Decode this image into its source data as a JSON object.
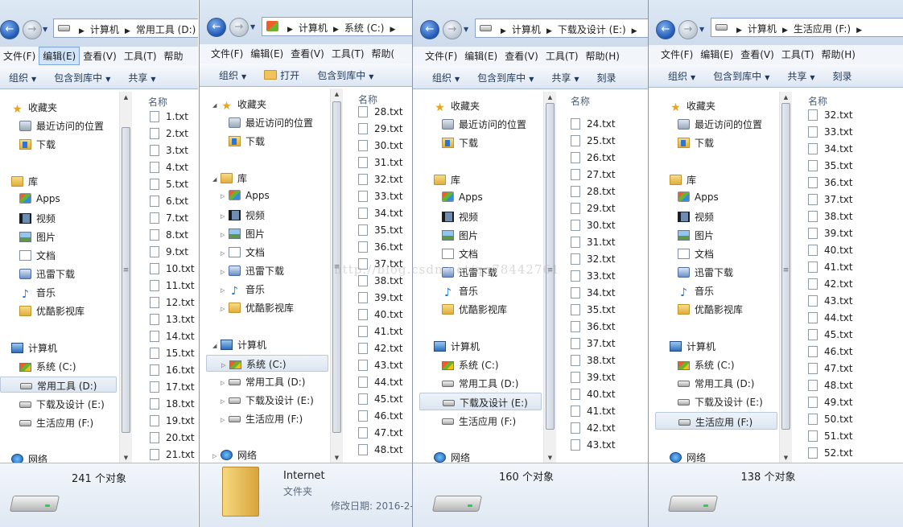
{
  "windows": [
    {
      "address": [
        "计算机",
        "常用工具 (D:)"
      ],
      "menu": [
        "文件(F)",
        "编辑(E)",
        "查看(V)",
        "工具(T)",
        "帮助"
      ],
      "active_menu": 1,
      "toolbar": [
        "组织",
        "包含到库中",
        "共享"
      ],
      "column_header": "名称",
      "files": [
        "1.txt",
        "2.txt",
        "3.txt",
        "4.txt",
        "5.txt",
        "6.txt",
        "7.txt",
        "8.txt",
        "9.txt",
        "10.txt",
        "11.txt",
        "12.txt",
        "13.txt",
        "14.txt",
        "15.txt",
        "16.txt",
        "17.txt",
        "18.txt",
        "19.txt",
        "20.txt",
        "21.txt"
      ],
      "object_count": "241 个对象",
      "nav": {
        "favorites": "收藏夹",
        "recent": "最近访问的位置",
        "downloads": "下载",
        "library": "库",
        "apps": "Apps",
        "video": "视频",
        "pictures": "图片",
        "docs": "文档",
        "xunlei": "迅雷下载",
        "music": "音乐",
        "youku": "优酷影视库",
        "computer": "计算机",
        "c": "系统 (C:)",
        "d": "常用工具 (D:)",
        "e": "下载及设计 (E:)",
        "f": "生活应用 (F:)",
        "network": "网络"
      }
    },
    {
      "address": [
        "计算机",
        "系统 (C:)"
      ],
      "menu": [
        "文件(F)",
        "编辑(E)",
        "查看(V)",
        "工具(T)",
        "帮助("
      ],
      "toolbar": [
        "组织",
        "打开",
        "包含到库中"
      ],
      "column_header": "名称",
      "files": [
        "28.txt",
        "29.txt",
        "30.txt",
        "31.txt",
        "32.txt",
        "33.txt",
        "34.txt",
        "35.txt",
        "36.txt",
        "37.txt",
        "38.txt",
        "39.txt",
        "40.txt",
        "41.txt",
        "42.txt",
        "43.txt",
        "44.txt",
        "45.txt",
        "46.txt",
        "47.txt",
        "48.txt"
      ],
      "details": {
        "name": "Internet",
        "type": "文件夹",
        "modified": "修改日期: 2016-2-"
      }
    },
    {
      "address": [
        "计算机",
        "下载及设计 (E:)"
      ],
      "menu": [
        "文件(F)",
        "编辑(E)",
        "查看(V)",
        "工具(T)",
        "帮助(H)"
      ],
      "toolbar": [
        "组织",
        "包含到库中",
        "共享",
        "刻录"
      ],
      "column_header": "名称",
      "files": [
        "24.txt",
        "25.txt",
        "26.txt",
        "27.txt",
        "28.txt",
        "29.txt",
        "30.txt",
        "31.txt",
        "32.txt",
        "33.txt",
        "34.txt",
        "35.txt",
        "36.txt",
        "37.txt",
        "38.txt",
        "39.txt",
        "40.txt",
        "41.txt",
        "42.txt",
        "43.txt"
      ],
      "object_count": "160 个对象"
    },
    {
      "address": [
        "计算机",
        "生活应用 (F:)"
      ],
      "menu": [
        "文件(F)",
        "编辑(E)",
        "查看(V)",
        "工具(T)",
        "帮助(H)"
      ],
      "toolbar": [
        "组织",
        "包含到库中",
        "共享",
        "刻录"
      ],
      "column_header": "名称",
      "files": [
        "32.txt",
        "33.txt",
        "34.txt",
        "35.txt",
        "36.txt",
        "37.txt",
        "38.txt",
        "39.txt",
        "40.txt",
        "41.txt",
        "42.txt",
        "43.txt",
        "44.txt",
        "45.txt",
        "46.txt",
        "47.txt",
        "48.txt",
        "49.txt",
        "50.txt",
        "51.txt",
        "52.txt"
      ],
      "object_count": "138 个对象"
    }
  ],
  "watermark": "http://blog.csdn.net/qq78442761"
}
